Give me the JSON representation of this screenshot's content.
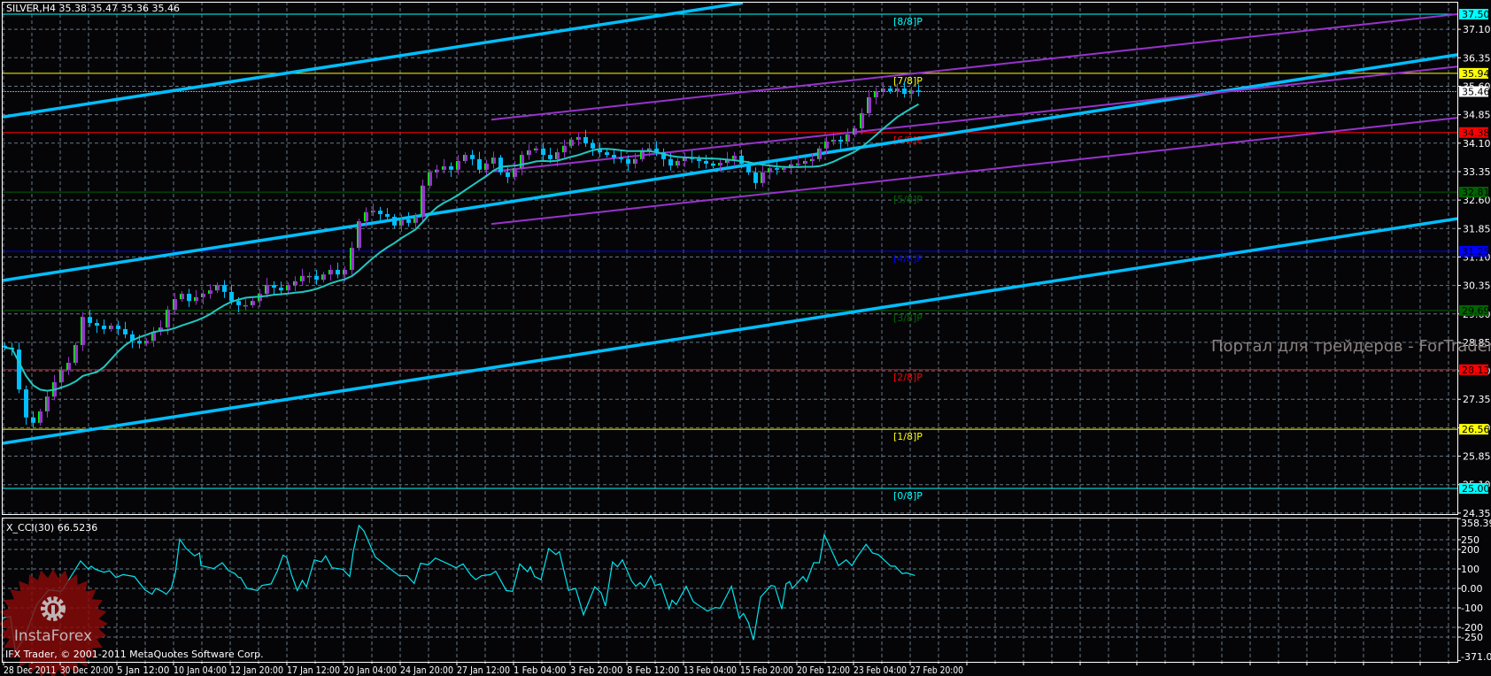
{
  "header": {
    "symbol_label": "SILVER,H4 35.38 35.47 35.36 35.46"
  },
  "indicator": {
    "label": "X_CCI(30) 66.5236"
  },
  "watermark": "Портал для трейдеров - ForTrader.ru",
  "copyright": "IFX Trader, © 2001-2011 MetaQuotes Software Corp.",
  "logo": {
    "text": "InstaForex",
    "icon": "gear-icon",
    "color": "#8B0A0A"
  },
  "colors": {
    "background": "#050508",
    "bull_candle": "#9932CC",
    "bull_accent": "#00FF00",
    "bear_candle": "#00BFFF",
    "moving_average": "#20C8C0",
    "trend_channel": "#00BFFF",
    "regression_channel": "#9932CC",
    "cci_line": "#00E5EE",
    "grid": "#7a8a9a"
  },
  "chart_data": {
    "type": "candlestick",
    "symbol": "SILVER",
    "timeframe": "H4",
    "price_axis": {
      "range": [
        24.35,
        37.8
      ],
      "ticks": [
        "37.10",
        "36.35",
        "35.60",
        "34.85",
        "34.10",
        "33.35",
        "32.60",
        "31.85",
        "31.10",
        "30.35",
        "29.60",
        "28.85",
        "28.10",
        "27.35",
        "26.60",
        "25.85",
        "25.10",
        "24.35"
      ],
      "tick_values": [
        37.1,
        36.35,
        35.6,
        34.85,
        34.1,
        33.35,
        32.6,
        31.85,
        31.1,
        30.35,
        29.6,
        28.85,
        28.1,
        27.35,
        26.6,
        25.85,
        25.1,
        24.35
      ]
    },
    "time_axis": {
      "labels": [
        "28 Dec 2011",
        "30 Dec 20:00",
        "5 Jan 12:00",
        "10 Jan 04:00",
        "12 Jan 20:00",
        "17 Jan 12:00",
        "20 Jan 04:00",
        "24 Jan 20:00",
        "27 Jan 12:00",
        "1 Feb 04:00",
        "3 Feb 20:00",
        "8 Feb 12:00",
        "13 Feb 04:00",
        "15 Feb 20:00",
        "20 Feb 12:00",
        "23 Feb 04:00",
        "27 Feb 20:00"
      ]
    },
    "close": [
      28.71,
      28.66,
      27.61,
      26.87,
      26.73,
      27.03,
      27.42,
      27.8,
      28.12,
      28.31,
      28.78,
      29.52,
      29.36,
      29.29,
      29.2,
      29.29,
      29.2,
      29.06,
      28.89,
      28.82,
      28.89,
      29.13,
      29.24,
      29.71,
      29.99,
      30.13,
      29.94,
      30.04,
      30.13,
      30.22,
      30.36,
      30.18,
      29.94,
      29.83,
      29.83,
      29.94,
      30.13,
      30.36,
      30.29,
      30.22,
      30.36,
      30.46,
      30.6,
      30.6,
      30.5,
      30.64,
      30.76,
      30.64,
      30.76,
      31.34,
      32.04,
      32.28,
      32.32,
      32.23,
      32.16,
      31.93,
      32.09,
      32.0,
      32.16,
      32.98,
      33.33,
      33.4,
      33.49,
      33.4,
      33.63,
      33.79,
      33.68,
      33.4,
      33.56,
      33.72,
      33.33,
      33.21,
      33.44,
      33.79,
      33.91,
      33.96,
      33.79,
      33.68,
      33.86,
      34.03,
      34.19,
      34.26,
      34.1,
      33.96,
      33.86,
      33.79,
      33.72,
      33.68,
      33.56,
      33.68,
      33.91,
      33.96,
      33.86,
      33.68,
      33.51,
      33.63,
      33.72,
      33.68,
      33.63,
      33.56,
      33.51,
      33.58,
      33.68,
      33.77,
      33.56,
      33.33,
      33.05,
      33.33,
      33.44,
      33.4,
      33.44,
      33.54,
      33.56,
      33.63,
      33.68,
      33.96,
      34.14,
      34.19,
      34.14,
      34.33,
      34.49,
      34.89,
      35.31,
      35.47,
      35.54,
      35.47,
      35.54,
      35.4,
      35.49,
      35.46
    ],
    "last_bar": {
      "open": 35.38,
      "high": 35.47,
      "low": 35.36,
      "close": 35.46
    },
    "current_price": {
      "value": 35.46,
      "text": "35.46"
    },
    "murrey_levels": [
      {
        "label": "[8/8]P",
        "price": 37.5,
        "text": "37.50",
        "color": "#00FFFF",
        "text_color": "#000000"
      },
      {
        "label": "[7/8]P",
        "price": 35.94,
        "text": "35.94",
        "color": "#FFFF00",
        "text_color": "#000000"
      },
      {
        "label": "[6/8]P",
        "price": 34.38,
        "text": "34.38",
        "color": "#FF0000",
        "text_color": "#000000"
      },
      {
        "label": "[5/8]P",
        "price": 32.81,
        "text": "32.81",
        "color": "#006400",
        "text_color": "#000000"
      },
      {
        "label": "[4/8]P",
        "price": 31.25,
        "text": "31.25",
        "color": "#0000FF",
        "text_color": "#000040"
      },
      {
        "label": "[3/8]P",
        "price": 29.69,
        "text": "29.69",
        "color": "#006400",
        "text_color": "#000000"
      },
      {
        "label": "[2/8]P",
        "price": 28.13,
        "text": "28.13",
        "color": "#FF0000",
        "text_color": "#000000"
      },
      {
        "label": "[1/8]P",
        "price": 26.56,
        "text": "26.56",
        "color": "#FFFF00",
        "text_color": "#000000"
      },
      {
        "label": "[0/8]P",
        "price": 25.0,
        "text": "25.00",
        "color": "#00FFFF",
        "text_color": "#000000"
      }
    ],
    "trend_lines": [
      {
        "kind": "channel",
        "from": [
          0,
          34.79
        ],
        "to": [
          104.5,
          37.8
        ]
      },
      {
        "kind": "channel",
        "from": [
          0,
          30.48
        ],
        "to": [
          205.4,
          36.43
        ]
      },
      {
        "kind": "channel",
        "from": [
          0,
          26.19
        ],
        "to": [
          205.4,
          32.11
        ]
      },
      {
        "kind": "regression",
        "from": [
          69,
          34.72
        ],
        "to": [
          205.4,
          37.5
        ]
      },
      {
        "kind": "regression",
        "from": [
          69,
          33.35
        ],
        "to": [
          205.4,
          36.12
        ]
      },
      {
        "kind": "regression",
        "from": [
          69,
          31.97
        ],
        "to": [
          205.4,
          34.77
        ]
      }
    ],
    "moving_average_period": 12,
    "cci": {
      "name": "X_CCI(30)",
      "last_value": 66.5236,
      "range": [
        -371.002,
        358.395
      ],
      "ticks": [
        "358.395",
        "250",
        "200",
        "100",
        "0.00",
        "-100",
        "-200",
        "-250",
        "-371.002"
      ],
      "tick_values": [
        358.395,
        250,
        200,
        100,
        0,
        -100,
        -200,
        -250,
        -371.002
      ],
      "points": [
        [
          0,
          -152
        ],
        [
          1.1,
          -144
        ],
        [
          1.8,
          -326
        ],
        [
          3.1,
          -250
        ],
        [
          4.8,
          -83
        ],
        [
          6.5,
          -8
        ],
        [
          8.3,
          -15
        ],
        [
          9.5,
          53
        ],
        [
          11,
          141
        ],
        [
          12.1,
          98
        ],
        [
          12.5,
          114
        ],
        [
          13.1,
          98
        ],
        [
          14.3,
          83
        ],
        [
          15.1,
          91
        ],
        [
          16,
          56
        ],
        [
          17,
          71
        ],
        [
          18.6,
          61
        ],
        [
          20.1,
          -8
        ],
        [
          21.1,
          -30
        ],
        [
          21.6,
          0
        ],
        [
          22.5,
          -15
        ],
        [
          23.1,
          -30
        ],
        [
          23.8,
          0
        ],
        [
          24.4,
          83
        ],
        [
          25,
          253
        ],
        [
          25.9,
          205
        ],
        [
          27.1,
          167
        ],
        [
          27.8,
          182
        ],
        [
          28,
          117
        ],
        [
          29.8,
          102
        ],
        [
          31,
          132
        ],
        [
          31.9,
          91
        ],
        [
          32.8,
          76
        ],
        [
          33.3,
          56
        ],
        [
          33.6,
          56
        ],
        [
          34.5,
          0
        ],
        [
          36,
          -11
        ],
        [
          36.6,
          15
        ],
        [
          37.9,
          23
        ],
        [
          38.8,
          91
        ],
        [
          39.6,
          171
        ],
        [
          40.1,
          159
        ],
        [
          40.8,
          68
        ],
        [
          41.6,
          -11
        ],
        [
          42.3,
          41
        ],
        [
          42.9,
          8
        ],
        [
          44,
          147
        ],
        [
          45,
          136
        ],
        [
          45.6,
          167
        ],
        [
          46.5,
          106
        ],
        [
          48,
          98
        ],
        [
          49,
          61
        ],
        [
          49.5,
          189
        ],
        [
          50.3,
          323
        ],
        [
          51,
          295
        ],
        [
          52.6,
          162
        ],
        [
          54.8,
          98
        ],
        [
          56,
          65
        ],
        [
          57.1,
          65
        ],
        [
          58.1,
          26
        ],
        [
          59,
          129
        ],
        [
          60.1,
          121
        ],
        [
          61.1,
          156
        ],
        [
          62.9,
          126
        ],
        [
          64,
          106
        ],
        [
          65,
          126
        ],
        [
          66.1,
          68
        ],
        [
          66.8,
          45
        ],
        [
          67.6,
          65
        ],
        [
          68.9,
          71
        ],
        [
          69.6,
          88
        ],
        [
          71.1,
          -11
        ],
        [
          72,
          -15
        ],
        [
          73,
          126
        ],
        [
          74.1,
          86
        ],
        [
          74.5,
          111
        ],
        [
          75.1,
          61
        ],
        [
          76,
          45
        ],
        [
          77.1,
          205
        ],
        [
          78.1,
          174
        ],
        [
          78.6,
          189
        ],
        [
          79.9,
          -11
        ],
        [
          80.9,
          0
        ],
        [
          82,
          -136
        ],
        [
          83.6,
          8
        ],
        [
          84.5,
          -23
        ],
        [
          85.1,
          -91
        ],
        [
          86.1,
          136
        ],
        [
          86.8,
          111
        ],
        [
          87.5,
          147
        ],
        [
          88.8,
          38
        ],
        [
          89.4,
          11
        ],
        [
          90,
          30
        ],
        [
          90.6,
          5
        ],
        [
          91.5,
          65
        ],
        [
          92.1,
          15
        ],
        [
          92.9,
          23
        ],
        [
          94.1,
          -106
        ],
        [
          94.5,
          -61
        ],
        [
          95.1,
          -83
        ],
        [
          96.5,
          11
        ],
        [
          97.5,
          -68
        ],
        [
          99.5,
          -117
        ],
        [
          100.6,
          -98
        ],
        [
          101.3,
          -102
        ],
        [
          102.9,
          11
        ],
        [
          104,
          -152
        ],
        [
          104.6,
          -129
        ],
        [
          105.3,
          -177
        ],
        [
          106,
          -265
        ],
        [
          107,
          -45
        ],
        [
          108.5,
          15
        ],
        [
          109,
          11
        ],
        [
          110,
          -106
        ],
        [
          110.6,
          23
        ],
        [
          111.1,
          35
        ],
        [
          111.5,
          0
        ],
        [
          113,
          61
        ],
        [
          113.5,
          35
        ],
        [
          114.5,
          132
        ],
        [
          115.3,
          132
        ],
        [
          116,
          277
        ],
        [
          118,
          117
        ],
        [
          119.1,
          147
        ],
        [
          119.9,
          117
        ],
        [
          120.6,
          159
        ],
        [
          121.9,
          227
        ],
        [
          122.8,
          182
        ],
        [
          123.6,
          174
        ],
        [
          125.4,
          114
        ],
        [
          126,
          114
        ],
        [
          127,
          76
        ],
        [
          127.6,
          80
        ],
        [
          128.8,
          66.5
        ]
      ]
    }
  }
}
